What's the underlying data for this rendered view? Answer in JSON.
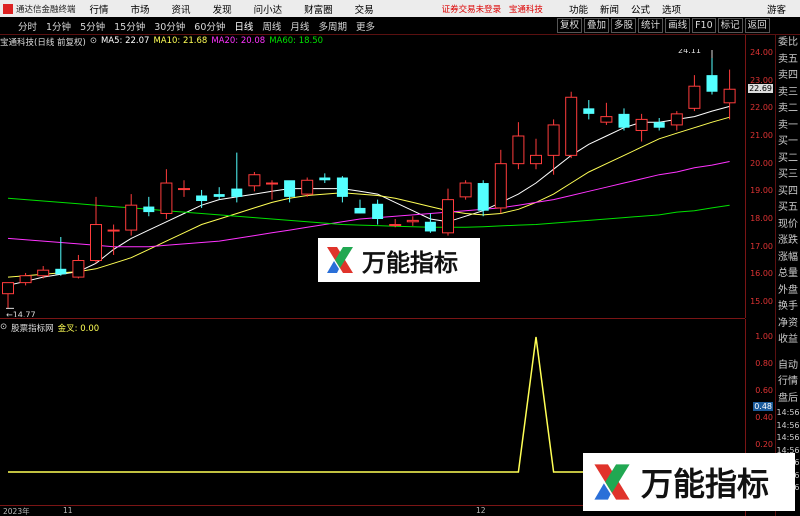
{
  "app": {
    "title": "通达信金融终端",
    "menu": [
      "行情",
      "市场",
      "资讯",
      "发现",
      "问小达",
      "财富圈",
      "交易"
    ],
    "status": [
      "证券交易未登录",
      "宝通科技"
    ],
    "right_menu": [
      "功能",
      "新闻",
      "公式",
      "选项"
    ],
    "guest": "游客"
  },
  "toolbar": {
    "periods": [
      "分时",
      "1分钟",
      "5分钟",
      "15分钟",
      "30分钟",
      "60分钟",
      "日线",
      "周线",
      "月线",
      "多周期",
      "更多"
    ],
    "active_period": "日线",
    "actions": [
      "复权",
      "叠加",
      "多股",
      "统计",
      "画线",
      "F10",
      "标记",
      "返回"
    ]
  },
  "main_chart": {
    "stock": "宝通科技(日线 前复权)",
    "ma": [
      {
        "label": "MA5: 22.07",
        "color": "#ffffff"
      },
      {
        "label": "MA10: 21.68",
        "color": "#ffff55"
      },
      {
        "label": "MA20: 20.08",
        "color": "#ff33ff"
      },
      {
        "label": "MA60: 18.50",
        "color": "#00e000"
      }
    ],
    "high_label": "24.11",
    "low_label": "14.77",
    "current_price": "22.69"
  },
  "sub_chart": {
    "name": "股票指标网",
    "value_label": "金叉: 0.00",
    "current_value": "0.48"
  },
  "side_panel": {
    "top": [
      "委比",
      "卖五",
      "卖四",
      "卖三",
      "卖二",
      "卖一",
      "买一",
      "买二",
      "买三",
      "买四",
      "买五",
      "现价",
      "涨跌",
      "涨幅",
      "总量",
      "外盘",
      "换手",
      "净资",
      "收益"
    ],
    "bottom": [
      "自动",
      "行情",
      "盘后"
    ],
    "times": [
      "14:56",
      "14:56",
      "14:56",
      "14:56",
      "14:56",
      "14:56",
      "14:56"
    ]
  },
  "dates": [
    "2023年",
    "11",
    "12"
  ],
  "watermark": "万能指标",
  "colors": {
    "up": "#ff3c3c",
    "down": "#54ffff",
    "axis": "#dd3333",
    "grid": "#7a1515",
    "indicator": "#ffff55"
  },
  "chart_data": [
    {
      "type": "candlestick",
      "title": "宝通科技(日线 前复权)",
      "ylim": [
        14.5,
        24.5
      ],
      "y_ticks": [
        15.0,
        16.0,
        17.0,
        18.0,
        19.0,
        20.0,
        21.0,
        22.0,
        23.0,
        24.0
      ],
      "candles": [
        {
          "o": 15.3,
          "c": 15.7,
          "h": 15.7,
          "l": 14.77
        },
        {
          "o": 15.7,
          "c": 15.95,
          "h": 16.05,
          "l": 15.6
        },
        {
          "o": 15.95,
          "c": 16.15,
          "h": 16.3,
          "l": 15.85
        },
        {
          "o": 16.2,
          "c": 16.0,
          "h": 17.35,
          "l": 15.95
        },
        {
          "o": 15.9,
          "c": 16.5,
          "h": 16.7,
          "l": 15.85
        },
        {
          "o": 16.5,
          "c": 17.8,
          "h": 18.8,
          "l": 16.4
        },
        {
          "o": 17.6,
          "c": 17.6,
          "h": 17.8,
          "l": 16.7
        },
        {
          "o": 17.6,
          "c": 18.5,
          "h": 18.9,
          "l": 17.4
        },
        {
          "o": 18.45,
          "c": 18.25,
          "h": 18.8,
          "l": 18.1
        },
        {
          "o": 18.2,
          "c": 19.3,
          "h": 19.8,
          "l": 18.0
        },
        {
          "o": 19.1,
          "c": 19.1,
          "h": 19.4,
          "l": 18.8
        },
        {
          "o": 18.85,
          "c": 18.65,
          "h": 19.05,
          "l": 18.4
        },
        {
          "o": 18.9,
          "c": 18.8,
          "h": 19.15,
          "l": 18.7
        },
        {
          "o": 19.1,
          "c": 18.8,
          "h": 20.4,
          "l": 18.6
        },
        {
          "o": 19.2,
          "c": 19.6,
          "h": 19.7,
          "l": 19.0
        },
        {
          "o": 19.3,
          "c": 19.3,
          "h": 19.4,
          "l": 18.7
        },
        {
          "o": 19.4,
          "c": 18.8,
          "h": 19.3,
          "l": 18.6
        },
        {
          "o": 18.9,
          "c": 19.4,
          "h": 19.5,
          "l": 18.8
        },
        {
          "o": 19.5,
          "c": 19.4,
          "h": 19.65,
          "l": 19.3
        },
        {
          "o": 19.5,
          "c": 18.8,
          "h": 19.55,
          "l": 18.6
        },
        {
          "o": 18.4,
          "c": 18.2,
          "h": 18.7,
          "l": 18.2
        },
        {
          "o": 18.55,
          "c": 18.0,
          "h": 18.7,
          "l": 17.8
        },
        {
          "o": 17.8,
          "c": 17.8,
          "h": 18.0,
          "l": 17.7
        },
        {
          "o": 17.9,
          "c": 17.95,
          "h": 18.1,
          "l": 17.75
        },
        {
          "o": 17.9,
          "c": 17.55,
          "h": 18.2,
          "l": 17.5
        },
        {
          "o": 17.5,
          "c": 18.7,
          "h": 19.1,
          "l": 17.4
        },
        {
          "o": 18.8,
          "c": 19.3,
          "h": 19.4,
          "l": 18.7
        },
        {
          "o": 19.3,
          "c": 18.3,
          "h": 19.4,
          "l": 18.1
        },
        {
          "o": 18.4,
          "c": 20.0,
          "h": 20.5,
          "l": 18.2
        },
        {
          "o": 20.0,
          "c": 21.0,
          "h": 21.5,
          "l": 19.8
        },
        {
          "o": 20.0,
          "c": 20.3,
          "h": 20.9,
          "l": 19.8
        },
        {
          "o": 20.3,
          "c": 21.4,
          "h": 21.6,
          "l": 19.6
        },
        {
          "o": 20.3,
          "c": 22.4,
          "h": 22.6,
          "l": 20.2
        },
        {
          "o": 22.0,
          "c": 21.8,
          "h": 22.3,
          "l": 21.6
        },
        {
          "o": 21.5,
          "c": 21.7,
          "h": 22.2,
          "l": 21.4
        },
        {
          "o": 21.8,
          "c": 21.3,
          "h": 22.0,
          "l": 21.2
        },
        {
          "o": 21.2,
          "c": 21.6,
          "h": 21.8,
          "l": 20.8
        },
        {
          "o": 21.5,
          "c": 21.3,
          "h": 21.65,
          "l": 21.2
        },
        {
          "o": 21.4,
          "c": 21.8,
          "h": 21.9,
          "l": 21.2
        },
        {
          "o": 22.0,
          "c": 22.8,
          "h": 23.2,
          "l": 21.9
        },
        {
          "o": 23.2,
          "c": 22.6,
          "h": 24.11,
          "l": 22.5
        },
        {
          "o": 22.2,
          "c": 22.69,
          "h": 23.4,
          "l": 21.6
        }
      ],
      "series": [
        {
          "name": "MA5",
          "values": [
            15.6,
            15.75,
            15.9,
            16.0,
            16.1,
            16.4,
            16.9,
            17.3,
            17.6,
            17.9,
            18.2,
            18.5,
            18.7,
            18.8,
            18.9,
            19.0,
            19.1,
            19.1,
            19.1,
            19.1,
            19.0,
            18.9,
            18.6,
            18.3,
            18.0,
            17.9,
            18.1,
            18.3,
            18.6,
            18.9,
            19.3,
            19.8,
            20.3,
            20.7,
            21.0,
            21.3,
            21.5,
            21.5,
            21.6,
            21.7,
            21.9,
            22.07
          ]
        },
        {
          "name": "MA10",
          "values": [
            15.9,
            15.95,
            16.0,
            16.05,
            16.1,
            16.2,
            16.4,
            16.6,
            16.9,
            17.2,
            17.5,
            17.8,
            18.0,
            18.2,
            18.4,
            18.6,
            18.75,
            18.85,
            18.9,
            18.95,
            18.9,
            18.85,
            18.75,
            18.6,
            18.45,
            18.3,
            18.2,
            18.15,
            18.2,
            18.35,
            18.6,
            18.9,
            19.3,
            19.7,
            20.0,
            20.3,
            20.6,
            20.9,
            21.1,
            21.3,
            21.5,
            21.68
          ]
        },
        {
          "name": "MA20",
          "values": [
            17.3,
            17.25,
            17.2,
            17.15,
            17.1,
            17.05,
            17.0,
            17.0,
            17.0,
            17.05,
            17.1,
            17.15,
            17.2,
            17.3,
            17.4,
            17.5,
            17.6,
            17.7,
            17.8,
            17.9,
            18.0,
            18.05,
            18.1,
            18.15,
            18.2,
            18.25,
            18.3,
            18.35,
            18.4,
            18.5,
            18.6,
            18.7,
            18.85,
            19.0,
            19.15,
            19.3,
            19.45,
            19.6,
            19.7,
            19.85,
            19.95,
            20.08
          ]
        },
        {
          "name": "MA60",
          "values": [
            18.75,
            18.7,
            18.65,
            18.6,
            18.55,
            18.5,
            18.45,
            18.4,
            18.35,
            18.3,
            18.25,
            18.2,
            18.15,
            18.1,
            18.05,
            18.0,
            17.95,
            17.9,
            17.85,
            17.8,
            17.78,
            17.76,
            17.74,
            17.72,
            17.7,
            17.7,
            17.7,
            17.72,
            17.75,
            17.78,
            17.8,
            17.85,
            17.9,
            17.95,
            18.0,
            18.05,
            18.1,
            18.15,
            18.25,
            18.3,
            18.4,
            18.5
          ]
        }
      ]
    },
    {
      "type": "line",
      "title": "股票指标网",
      "ylim": [
        0,
        1.1
      ],
      "y_ticks": [
        "1.00",
        "0.80",
        "0.60",
        "0.40",
        "0.20"
      ],
      "series": [
        {
          "name": "金叉",
          "values": [
            0,
            0,
            0,
            0,
            0,
            0,
            0,
            0,
            0,
            0,
            0,
            0,
            0,
            0,
            0,
            0,
            0,
            0,
            0,
            0,
            0,
            0,
            0,
            0,
            0,
            0,
            0,
            0,
            0,
            0,
            1,
            0,
            0,
            0,
            0,
            0,
            0,
            0,
            0,
            0,
            0,
            0
          ]
        }
      ]
    }
  ]
}
